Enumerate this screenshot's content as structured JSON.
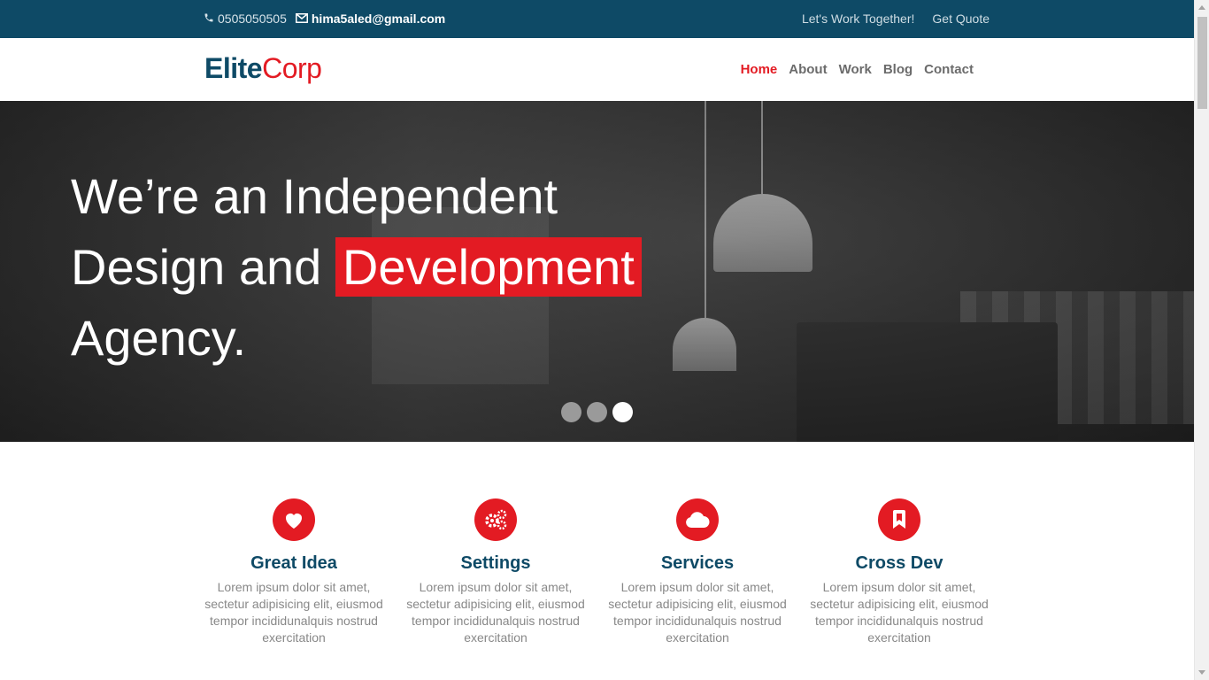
{
  "topbar": {
    "phone_icon": "phone-icon",
    "phone": "0505050505",
    "email_icon": "envelope-icon",
    "email": "hima5aled@gmail.com",
    "links": [
      "Let's Work Together!",
      "Get Quote"
    ]
  },
  "header": {
    "logo_part1": "Elite",
    "logo_part2": "Corp",
    "nav": [
      "Home",
      "About",
      "Work",
      "Blog",
      "Contact"
    ],
    "active": "Home"
  },
  "hero": {
    "line1": "We’re an Independent",
    "line2_a": "Design and",
    "line2_highlight": "Development",
    "line3": "Agency.",
    "slides": 3,
    "active_slide": 3
  },
  "features": [
    {
      "icon": "heart-icon",
      "title": "Great Idea",
      "text": "Lorem ipsum dolor sit amet, sectetur adipisicing elit, eiusmod tempor incididunalquis nostrud exercitation"
    },
    {
      "icon": "gears-icon",
      "title": "Settings",
      "text": "Lorem ipsum dolor sit amet, sectetur adipisicing elit, eiusmod tempor incididunalquis nostrud exercitation"
    },
    {
      "icon": "cloud-icon",
      "title": "Services",
      "text": "Lorem ipsum dolor sit amet, sectetur adipisicing elit, eiusmod tempor incididunalquis nostrud exercitation"
    },
    {
      "icon": "bookmark-icon",
      "title": "Cross Dev",
      "text": "Lorem ipsum dolor sit amet, sectetur adipisicing elit, eiusmod tempor incididunalquis nostrud exercitation"
    }
  ],
  "colors": {
    "primary": "#0e4a66",
    "accent": "#e31b23"
  }
}
